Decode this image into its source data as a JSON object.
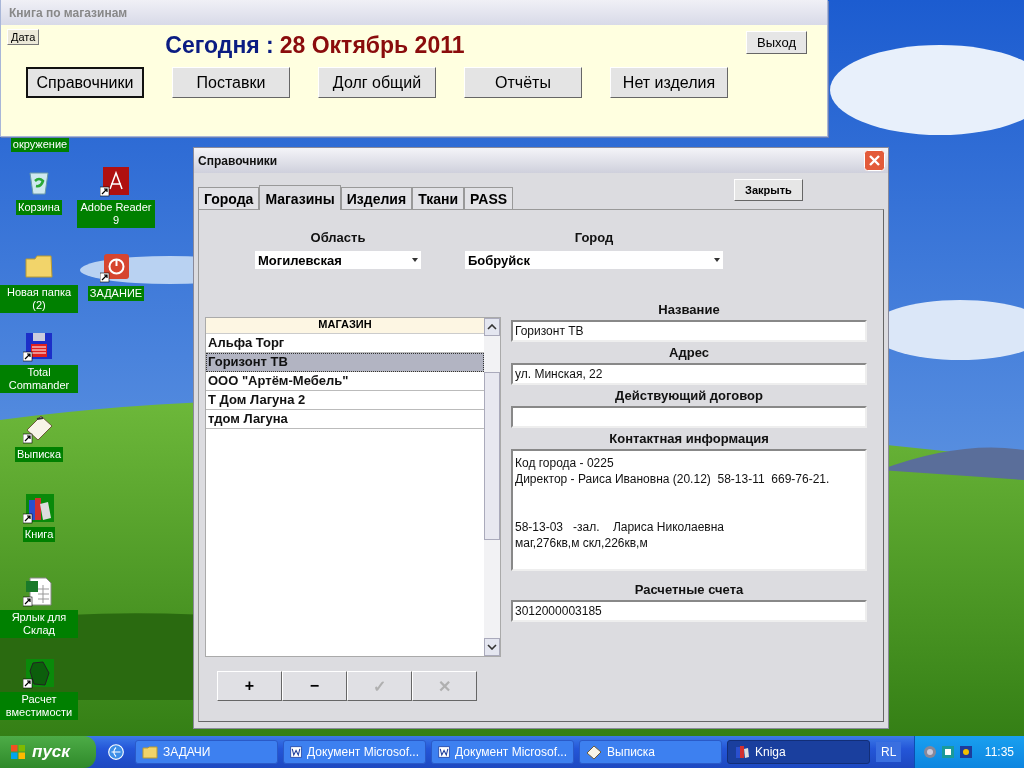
{
  "main_window": {
    "title": "Книга по магазинам",
    "date_button": "Дата",
    "today_label": "Сегодня :",
    "today_date": "28 Октябрь 2011",
    "exit_button": "Выход",
    "nav_buttons": [
      {
        "label": "Справочники",
        "selected": true
      },
      {
        "label": "Поставки",
        "selected": false
      },
      {
        "label": "Долг общий",
        "selected": false
      },
      {
        "label": "Отчёты",
        "selected": false
      },
      {
        "label": "Нет изделия",
        "selected": false
      }
    ]
  },
  "desktop_icons": [
    {
      "label": "окружение",
      "kind": "covered"
    },
    {
      "label": "Корзина",
      "kind": "recycle-bin",
      "shortcut": false
    },
    {
      "label": "Adobe Reader 9",
      "kind": "pdf",
      "shortcut": true
    },
    {
      "label": "Новая папка (2)",
      "kind": "folder",
      "shortcut": false
    },
    {
      "label": "ЗАДАНИЕ",
      "kind": "power",
      "shortcut": true
    },
    {
      "label": "Total Commander",
      "kind": "floppy",
      "shortcut": true
    },
    {
      "label": "Выписка",
      "kind": "clipboard",
      "shortcut": true
    },
    {
      "label": "Книга",
      "kind": "books",
      "shortcut": true
    },
    {
      "label": "Ярлык для Склад",
      "kind": "spreadsheet",
      "shortcut": true
    },
    {
      "label": "Расчет вместимости",
      "kind": "blob",
      "shortcut": true
    }
  ],
  "dialog": {
    "title": "Справочники",
    "close_button": "Закрыть",
    "tabs": [
      {
        "label": "Города",
        "selected": false
      },
      {
        "label": "Магазины",
        "selected": true
      },
      {
        "label": "Изделия",
        "selected": false
      },
      {
        "label": "Ткани",
        "selected": false
      },
      {
        "label": "PASS",
        "selected": false
      }
    ],
    "region": {
      "label": "Область",
      "value": "Могилевская"
    },
    "city": {
      "label": "Город",
      "value": "Бобруйск"
    },
    "shop_list": {
      "header": "МАГАЗИН",
      "rows": [
        {
          "name": "Альфа Торг",
          "selected": false
        },
        {
          "name": "Горизонт ТВ",
          "selected": true
        },
        {
          "name": "ООО \"Артём-Мебель\"",
          "selected": false
        },
        {
          "name": "Т Дом Лагуна 2",
          "selected": false
        },
        {
          "name": "тдом Лагуна",
          "selected": false
        }
      ]
    },
    "fields": [
      {
        "label": "Название",
        "value": "Горизонт ТВ",
        "kind": "line"
      },
      {
        "label": "Адрес",
        "value": "ул. Минская, 22",
        "kind": "line"
      },
      {
        "label": "Действующий договор",
        "kind": "line"
      },
      {
        "label": "Контактная информация",
        "value": "Код города - 0225\nДиректор - Раиса Ивановна (20.12)  58-13-11  669-76-21.\n\n\n58-13-03   -зал.    Лариса Николаевна\nмаг,276кв,м скл,226кв,м",
        "kind": "memo"
      },
      {
        "label": "Расчетные счета",
        "value": "3012000003185",
        "kind": "line"
      }
    ],
    "record_buttons": [
      {
        "label": "+",
        "disabled": false
      },
      {
        "label": "−",
        "disabled": false
      },
      {
        "label": "✓",
        "disabled": true
      },
      {
        "label": "✕",
        "disabled": true
      }
    ]
  },
  "taskbar": {
    "start": "пуск",
    "tasks": [
      {
        "label": "ЗАДАЧИ",
        "kind": "folder",
        "selected": false
      },
      {
        "label": "Документ Microsof...",
        "kind": "word",
        "selected": false
      },
      {
        "label": "Документ Microsof...",
        "kind": "word",
        "selected": false
      },
      {
        "label": "Выписка",
        "kind": "clipboard",
        "selected": false
      },
      {
        "label": "Kniga",
        "kind": "books",
        "selected": true
      }
    ],
    "language": "RL",
    "clock": "11:35"
  }
}
